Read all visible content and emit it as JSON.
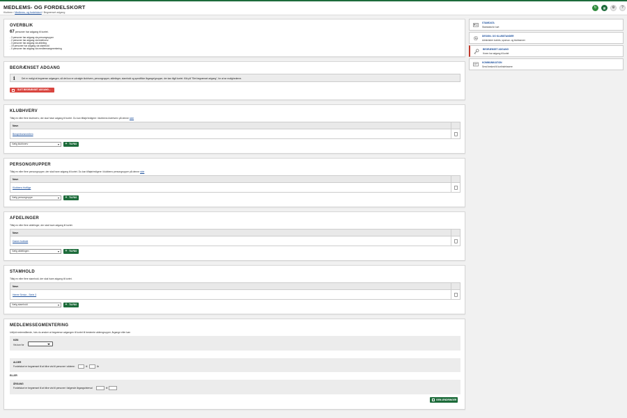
{
  "header": {
    "title": "MEDLEMS- OG FORDELSKORT",
    "breadcrumb": {
      "home": "Klubben",
      "parent": "Medlems- og fordelskort",
      "current": "Begrænset adgang"
    },
    "buttons": {
      "refresh": "↻",
      "grid": "▦",
      "settings": "⚙",
      "help": "?"
    }
  },
  "overview": {
    "title": "OVERBLIK",
    "count": "67",
    "count_text": "personer har adgang til kortet.",
    "items": [
      "- 3 personer har adgang via persongrupper",
      "- 2 personer har adgang via klubhverv",
      "- 3 personer har adgang via afdeling",
      "- 19 personer har adgang via stamhold",
      "- 0 personer har adgang via medlemssegmentering"
    ]
  },
  "restricted": {
    "title": "BEGRÆNSET ADGANG",
    "info": "Det er muligt at begrænse adgangen, så det kun er udvalgte klubhverv, persongrupper, afdelinger, stamhold og specifikke årgange/grupper, der kan tilgå kortet. Klik på \"Slet begrænset adgang\", for at se mulighederne.",
    "delete_label": "SLET BEGRÆNSET ADGANG..."
  },
  "sections": [
    {
      "key": "klubhverv",
      "title": "KLUBHVERV",
      "desc": "Tilføj en eller flere klubhverv, der skal have adgang til kortet. Du kan tilføje/redigere i klubbens klubhverv på denne ",
      "link": "side",
      "col_header": "Navn",
      "rows": [
        "Bestyrelsesmedlem"
      ],
      "select_placeholder": "Vælg klubhverv",
      "add_label": "TILFØJ"
    },
    {
      "key": "persongrupper",
      "title": "PERSONGRUPPER",
      "desc": "Tilføj en eller flere persongrupper, der skal have adgang til kortet. Du kan tilføje/redigere i klubbens persongrupper på denne ",
      "link": "side",
      "col_header": "Navn",
      "rows": [
        "Klubbens frivillige"
      ],
      "select_placeholder": "Vælg persongruppe",
      "add_label": "TILFØJ"
    },
    {
      "key": "afdelinger",
      "title": "AFDELINGER",
      "desc": "Tilføj en eller flere afdelinger, der skal have adgang til kortet.",
      "link": "",
      "col_header": "Navn",
      "rows": [
        "Damer fodbold"
      ],
      "select_placeholder": "Vælg afdelingen",
      "add_label": "TILFØJ"
    },
    {
      "key": "stamhold",
      "title": "STAMHOLD",
      "desc": "Tilføj en eller flere stamhold, der skal have adgang til kortet.",
      "link": "",
      "col_header": "Navn",
      "rows": [
        "Herrer Senior - Serie 3"
      ],
      "select_placeholder": "Vælg stamhold",
      "add_label": "TILFØJ"
    }
  ],
  "segmentation": {
    "title": "MEDLEMSSEGMENTERING",
    "desc": "Udfyld nedenstående, hvis du ønsker at begrænse adgangen til kortet til bestemte aldersgrupper, årgange eller køn",
    "gender_title": "KØN",
    "gender_label": "Vis kun for",
    "age_title": "ALDER",
    "age_text": "Fordelskort er begrænset til at blive vist til personer i alderen",
    "age_to": "til",
    "age_suffix": "år",
    "or": "ELLER",
    "year_title": "ÅRGANG",
    "year_text": "Fordelskort er begrænset til at blive vist til personer i følgende årgangsinterval",
    "year_to": "til",
    "save_label": "GEM ÆNDRINGER"
  },
  "sidebar": [
    {
      "title": "STAMDATA",
      "desc": "Stamdata for kort"
    },
    {
      "title": "DESIGN- OG KLUBSTANDER",
      "desc": "Administrer kortets, sponsor- og klubbanner"
    },
    {
      "title": "BEGRÆNSET ADGANG",
      "desc": "Hvem har adgang til kortet"
    },
    {
      "title": "KOMMUNIKATION",
      "desc": "Send besked til kortindehavere"
    }
  ],
  "colors": {
    "brand_green": "#1c6b3a",
    "danger": "#d9453f",
    "link": "#1b4f9c"
  }
}
